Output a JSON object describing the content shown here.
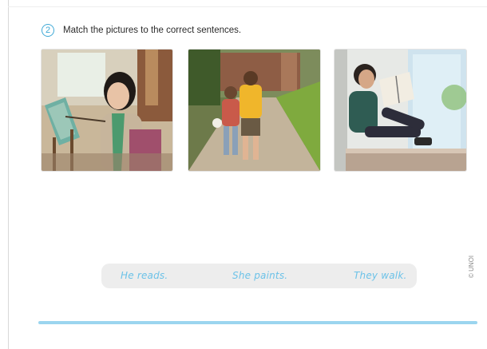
{
  "exercise": {
    "number": "2",
    "instruction": "Match the pictures to the correct sentences."
  },
  "pictures": [
    {
      "name": "girl-painting"
    },
    {
      "name": "boys-walking"
    },
    {
      "name": "boy-reading"
    }
  ],
  "answers": [
    "He reads.",
    "She paints.",
    "They walk."
  ],
  "copyright": "© UNOI",
  "colors": {
    "accent": "#3fa9d6",
    "answer_text": "#6cc2e8",
    "answer_bar": "#ededed",
    "bottom_line": "#9bd5ef"
  }
}
